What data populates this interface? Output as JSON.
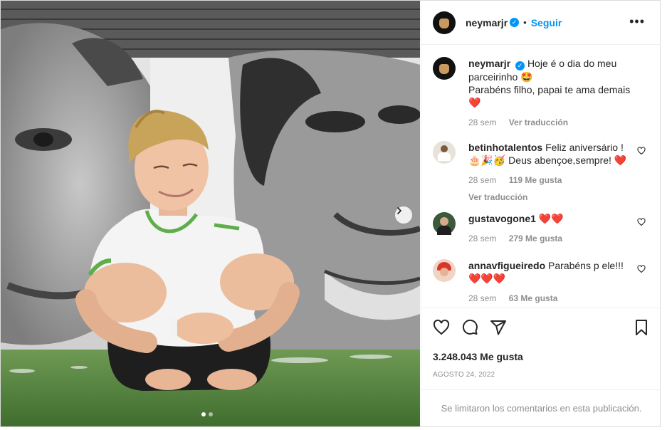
{
  "post": {
    "author": "neymarjr",
    "follow_label": "Seguir",
    "separator": "•",
    "more_label": "•••",
    "verified_glyph": "✓"
  },
  "caption": {
    "username": "neymarjr",
    "line1": "Hoje é o dia do meu parceirinho 🤩",
    "line2": "Parabéns filho, papai te ama demais",
    "line3": "❤️",
    "time": "28 sem",
    "translate": "Ver traducción"
  },
  "comments": [
    {
      "username": "betinhotalentos",
      "text1": "Feliz aniversário !",
      "text2": "🎂🎉🥳 Deus abençoe,sempre! ❤️",
      "time": "28 sem",
      "likes": "119 Me gusta",
      "translate": "Ver traducción",
      "avatar_color": "#e8e3d8"
    },
    {
      "username": "gustavogone1",
      "text1": "❤️❤️",
      "time": "28 sem",
      "likes": "279 Me gusta",
      "avatar_color": "#3c5a3a"
    },
    {
      "username": "annavfigueiredo",
      "text1": "Parabéns p ele!!!",
      "text2": "❤️❤️❤️",
      "time": "28 sem",
      "likes": "63 Me gusta",
      "avatar_color": "#d9362b"
    }
  ],
  "actions": {
    "like_icon": "heart-icon",
    "comment_icon": "comment-icon",
    "share_icon": "share-icon",
    "save_icon": "bookmark-icon"
  },
  "likes_count": "3.248.043 Me gusta",
  "post_date": "AGOSTO 24, 2022",
  "comments_limited": "Se limitaron los comentarios en esta publicación.",
  "carousel": {
    "slide_count": 2,
    "active_slide": 1
  },
  "colors": {
    "accent": "#0095f6",
    "like_red": "#ed4956",
    "muted": "#8e8e8e",
    "border": "#efefef"
  }
}
